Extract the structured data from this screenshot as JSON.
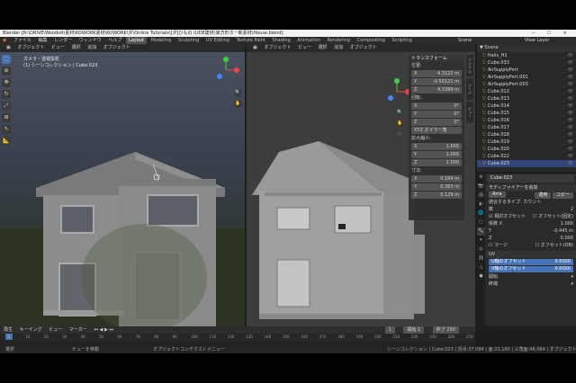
{
  "title": "Blender [N:\\DRIVE\\Wooduth素材\\KOWORK素材\\KOWORK\\ダ\\Online Tutorials\\[ダ]ひもの (UDE建材)家方形ホー新素材\\House.blend]",
  "menu": [
    "ファイル",
    "編集",
    "レンダー",
    "ウィンドウ",
    "ヘルプ"
  ],
  "workspaces": [
    "Layout",
    "Modeling",
    "Sculpting",
    "UV Editing",
    "Texture Paint",
    "Shading",
    "Animation",
    "Rendering",
    "Compositing",
    "Scripting"
  ],
  "active_workspace": "Layout",
  "scene_label": "Scene",
  "view_layer_label": "View Layer",
  "left_vp": {
    "header": [
      "オブジェクト",
      "ビュー",
      "選択",
      "追加",
      "オブジェクト"
    ],
    "camera_line": "カメラ・透視投影",
    "collection_line": "(1) シーンコレクション | Cube.023"
  },
  "right_vp": {
    "header": [
      "オブジェクト",
      "ビュー",
      "選択",
      "追加",
      "オブジェクト"
    ]
  },
  "npanel": {
    "header": "トランスフォーム",
    "loc_label": "位置:",
    "loc": [
      [
        "X",
        "4.3122 m"
      ],
      [
        "Y",
        "-0.50121 m"
      ],
      [
        "Z",
        "4.3389 m"
      ]
    ],
    "rot_label": "回転:",
    "rot": [
      [
        "X",
        "0°"
      ],
      [
        "Y",
        "0°"
      ],
      [
        "Z",
        "0°"
      ]
    ],
    "mode": "XYZ オイラー角",
    "scale_label": "拡大縮小:",
    "scale": [
      [
        "X",
        "1.000"
      ],
      [
        "Y",
        "1.000"
      ],
      [
        "Z",
        "1.000"
      ]
    ],
    "dim_label": "寸法:",
    "dim": [
      [
        "X",
        "0.184 m"
      ],
      [
        "Y",
        "0.383 m"
      ],
      [
        "Z",
        "0.129 m"
      ]
    ],
    "tabs": [
      "アイテム",
      "ツール",
      "ビュー"
    ]
  },
  "outliner": {
    "header": "▼ Scene",
    "items": [
      "Halls_H1",
      "Cube.033",
      "AirSupplyPort",
      "AirSupplyPort.001",
      "AirSupplyPort.003",
      "Cube.012",
      "Cube.013",
      "Cube.014",
      "Cube.015",
      "Cube.016",
      "Cube.017",
      "Cube.018",
      "Cube.019",
      "Cube.020",
      "Cube.022",
      "Cube.023"
    ],
    "selected_index": 15
  },
  "props": {
    "object": "Cube.023",
    "modifier_add": "モディファイアーを追加",
    "modifier_name": "Arra",
    "apply": "適用",
    "copy": "コピー",
    "fit_type": "適合するタイプ: カウント",
    "count_label": "数",
    "count": "2",
    "relative_offset": "相対オフセット",
    "constant_offset": "オフセット(固定)",
    "factors": [
      [
        "係数 X",
        "1.000"
      ],
      [
        "Y",
        "-0.445 m"
      ],
      [
        "Z",
        "0.000"
      ]
    ],
    "merge": "マージ",
    "object_offset": "オフセット(OB)",
    "uv": "UV",
    "uv_offset_u": [
      "U軸のオフセット",
      "0.0000"
    ],
    "uv_offset_v": [
      "V軸のオフセット",
      "0.0000"
    ],
    "start_cap": "開始",
    "end_cap": "終端"
  },
  "timeline": {
    "header": [
      "再生",
      "キーイング",
      "ビュー",
      "マーカー"
    ],
    "current_frame": "1",
    "start": "開始 1",
    "end": "終了 250",
    "ticks": [
      "0",
      "10",
      "20",
      "30",
      "40",
      "50",
      "60",
      "70",
      "80",
      "90",
      "100",
      "110",
      "120",
      "130",
      "140",
      "150",
      "160",
      "170",
      "180",
      "190",
      "200",
      "210",
      "220",
      "230",
      "240",
      "250"
    ]
  },
  "status": {
    "select": "選択",
    "view_move": "ビューを移動",
    "context_menu": "オブジェクトコンテクストメニュー",
    "stats": "シーンコレクション | Cube.023 | 頂点:37,084 | 面:23,180 | 三角面:46,064 | オブジェクト:0/84 | 2.92"
  }
}
